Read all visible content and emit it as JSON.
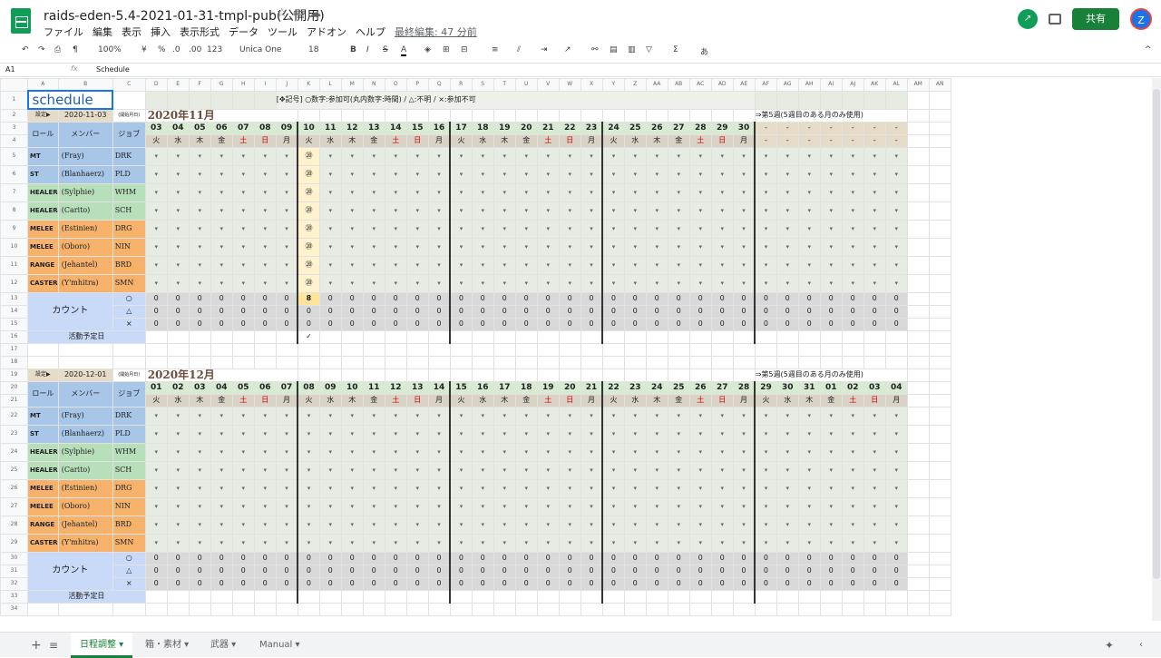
{
  "doc": {
    "title": "raids-eden-5.4-2021-01-31-tmpl-pub(公開用)",
    "menus": [
      "ファイル",
      "編集",
      "表示",
      "挿入",
      "表示形式",
      "データ",
      "ツール",
      "アドオン",
      "ヘルプ"
    ],
    "last_edit": "最終編集: 47 分前",
    "share_label": "共有",
    "avatar": "Z"
  },
  "toolbar": {
    "zoom": "100%",
    "currency": "¥",
    "percent": "%",
    "dec_less": ".0",
    "dec_more": ".00",
    "format": "123",
    "font": "Unica One",
    "size": "18",
    "bold": "B",
    "italic": "I",
    "strike": "S",
    "text_color": "A",
    "input_tool": "あ"
  },
  "formula": {
    "cell_ref": "A1",
    "fx": "fx",
    "content": "Schedule"
  },
  "columns": [
    "A",
    "B",
    "C",
    "D",
    "E",
    "F",
    "G",
    "H",
    "I",
    "J",
    "K",
    "L",
    "M",
    "N",
    "O",
    "P",
    "Q",
    "R",
    "S",
    "T",
    "U",
    "V",
    "W",
    "X",
    "Y",
    "Z",
    "AA",
    "AB",
    "AC",
    "AD",
    "AE",
    "AF",
    "AG",
    "AH",
    "AI",
    "AJ",
    "AK",
    "AL",
    "AM",
    "AN"
  ],
  "sheet": {
    "title": "schedule",
    "legend": "[✥記号] ○数字:参加可(丸内数字:時間) / △:不明 / ×:参加不可",
    "blocks": [
      {
        "setting": "設定▶",
        "start": "2020-11-03",
        "note": "(開始月日)",
        "month": "2020年11月",
        "week5": "⇒第5週(5週目のある月のみ使用)",
        "dates": [
          "03",
          "04",
          "05",
          "06",
          "07",
          "08",
          "09",
          "10",
          "11",
          "12",
          "13",
          "14",
          "15",
          "16",
          "17",
          "18",
          "19",
          "20",
          "21",
          "22",
          "23",
          "24",
          "25",
          "26",
          "27",
          "28",
          "29",
          "30",
          "-",
          "-",
          "-",
          "-",
          "-",
          "-",
          "-"
        ],
        "dows": [
          "火",
          "水",
          "木",
          "金",
          "土",
          "日",
          "月",
          "火",
          "水",
          "木",
          "金",
          "土",
          "日",
          "月",
          "火",
          "水",
          "木",
          "金",
          "土",
          "日",
          "月",
          "火",
          "水",
          "木",
          "金",
          "土",
          "日",
          "月",
          "-",
          "-",
          "-",
          "-",
          "-",
          "-",
          "-"
        ],
        "counts": {
          "o": [
            "0",
            "0",
            "0",
            "0",
            "0",
            "0",
            "0",
            "8",
            "0",
            "0",
            "0",
            "0",
            "0",
            "0",
            "0",
            "0",
            "0",
            "0",
            "0",
            "0",
            "0",
            "0",
            "0",
            "0",
            "0",
            "0",
            "0",
            "0",
            "0",
            "0",
            "0",
            "0",
            "0",
            "0",
            "0"
          ],
          "t": [
            "0",
            "0",
            "0",
            "0",
            "0",
            "0",
            "0",
            "0",
            "0",
            "0",
            "0",
            "0",
            "0",
            "0",
            "0",
            "0",
            "0",
            "0",
            "0",
            "0",
            "0",
            "0",
            "0",
            "0",
            "0",
            "0",
            "0",
            "0",
            "0",
            "0",
            "0",
            "0",
            "0",
            "0",
            "0"
          ],
          "x": [
            "0",
            "0",
            "0",
            "0",
            "0",
            "0",
            "0",
            "0",
            "0",
            "0",
            "0",
            "0",
            "0",
            "0",
            "0",
            "0",
            "0",
            "0",
            "0",
            "0",
            "0",
            "0",
            "0",
            "0",
            "0",
            "0",
            "0",
            "0",
            "0",
            "0",
            "0",
            "0",
            "0",
            "0",
            "0"
          ]
        },
        "check": "✓"
      },
      {
        "setting": "設定▶",
        "start": "2020-12-01",
        "note": "(開始月日)",
        "month": "2020年12月",
        "week5": "⇒第5週(5週目のある月のみ使用)",
        "dates": [
          "01",
          "02",
          "03",
          "04",
          "05",
          "06",
          "07",
          "08",
          "09",
          "10",
          "11",
          "12",
          "13",
          "14",
          "15",
          "16",
          "17",
          "18",
          "19",
          "20",
          "21",
          "22",
          "23",
          "24",
          "25",
          "26",
          "27",
          "28",
          "29",
          "30",
          "31",
          "01",
          "02",
          "03",
          "04"
        ],
        "dows": [
          "火",
          "水",
          "木",
          "金",
          "土",
          "日",
          "月",
          "火",
          "水",
          "木",
          "金",
          "土",
          "日",
          "月",
          "火",
          "水",
          "木",
          "金",
          "土",
          "日",
          "月",
          "火",
          "水",
          "木",
          "金",
          "土",
          "日",
          "月",
          "火",
          "水",
          "木",
          "金",
          "土",
          "日",
          "月"
        ],
        "counts": {
          "o": [
            "0",
            "0",
            "0",
            "0",
            "0",
            "0",
            "0",
            "0",
            "0",
            "0",
            "0",
            "0",
            "0",
            "0",
            "0",
            "0",
            "0",
            "0",
            "0",
            "0",
            "0",
            "0",
            "0",
            "0",
            "0",
            "0",
            "0",
            "0",
            "0",
            "0",
            "0",
            "0",
            "0",
            "0",
            "0"
          ],
          "t": [
            "0",
            "0",
            "0",
            "0",
            "0",
            "0",
            "0",
            "0",
            "0",
            "0",
            "0",
            "0",
            "0",
            "0",
            "0",
            "0",
            "0",
            "0",
            "0",
            "0",
            "0",
            "0",
            "0",
            "0",
            "0",
            "0",
            "0",
            "0",
            "0",
            "0",
            "0",
            "0",
            "0",
            "0",
            "0"
          ],
          "x": [
            "0",
            "0",
            "0",
            "0",
            "0",
            "0",
            "0",
            "0",
            "0",
            "0",
            "0",
            "0",
            "0",
            "0",
            "0",
            "0",
            "0",
            "0",
            "0",
            "0",
            "0",
            "0",
            "0",
            "0",
            "0",
            "0",
            "0",
            "0",
            "0",
            "0",
            "0",
            "0",
            "0",
            "0",
            "0"
          ]
        },
        "check": ""
      }
    ],
    "headers": {
      "role": "ロール",
      "member": "メンバー",
      "job": "ジョブ",
      "count": "カウント",
      "sym_o": "○",
      "sym_t": "△",
      "sym_x": "×",
      "activity": "活動予定日"
    },
    "members": [
      {
        "role": "MT",
        "name": "(Fray)",
        "job": "DRK",
        "group": "tank"
      },
      {
        "role": "ST",
        "name": "(Blanhaerz)",
        "job": "PLD",
        "group": "tank"
      },
      {
        "role": "HEALER",
        "name": "(Sylphie)",
        "job": "WHM",
        "group": "heal"
      },
      {
        "role": "HEALER",
        "name": "(Carito)",
        "job": "SCH",
        "group": "heal"
      },
      {
        "role": "MELEE",
        "name": "(Estinien)",
        "job": "DRG",
        "group": "dps"
      },
      {
        "role": "MELEE",
        "name": "(Oboro)",
        "job": "NIN",
        "group": "dps"
      },
      {
        "role": "RANGE",
        "name": "(Jehantel)",
        "job": "BRD",
        "group": "dps"
      },
      {
        "role": "CASTER",
        "name": "(Y'mhitra)",
        "job": "SMN",
        "group": "dps"
      }
    ],
    "mark_nov10": "⑳"
  },
  "tabs": [
    "日程調整",
    "箱・素材",
    "武器",
    "Manual"
  ]
}
